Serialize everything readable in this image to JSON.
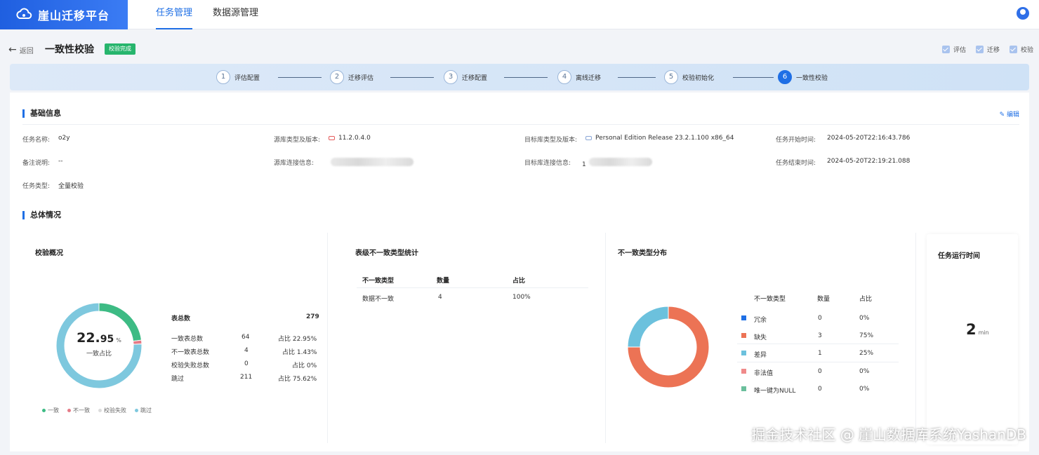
{
  "app": {
    "brand": "崖山迁移平台"
  },
  "nav": {
    "tabs": [
      {
        "label": "任务管理",
        "active": true
      },
      {
        "label": "数据源管理",
        "active": false
      }
    ]
  },
  "header": {
    "back_label": "返回",
    "title": "一致性校验",
    "status_badge": "校验完成",
    "checks": [
      {
        "label": "评估"
      },
      {
        "label": "迁移"
      },
      {
        "label": "校验"
      }
    ]
  },
  "stepper": {
    "steps": [
      {
        "num": "1",
        "label": "评估配置"
      },
      {
        "num": "2",
        "label": "迁移评估"
      },
      {
        "num": "3",
        "label": "迁移配置"
      },
      {
        "num": "4",
        "label": "离线迁移"
      },
      {
        "num": "5",
        "label": "校验初始化"
      },
      {
        "num": "6",
        "label": "一致性校验",
        "active": true
      }
    ]
  },
  "basic_info": {
    "title": "基础信息",
    "edit_label": "编辑",
    "task_name_label": "任务名称:",
    "task_name": "o2y",
    "remark_label": "备注说明:",
    "remark": "--",
    "task_type_label": "任务类型:",
    "task_type": "全量校验",
    "source_type_label": "源库类型及版本:",
    "source_type": "11.2.0.4.0",
    "source_conn_label": "源库连接信息:",
    "target_type_label": "目标库类型及版本:",
    "target_type": "Personal Edition Release 23.2.1.100 x86_64",
    "target_conn_label": "目标库连接信息:",
    "target_conn_prefix": "1",
    "start_time_label": "任务开始时间:",
    "start_time": "2024-05-20T22:16:43.786",
    "end_time_label": "任务结束时间:",
    "end_time": "2024-05-20T22:19:21.088"
  },
  "overview": {
    "title": "总体情况",
    "check_summary": {
      "title": "校验概况",
      "center_value_int": "22.",
      "center_value_dec": "95",
      "center_unit": "%",
      "center_label": "一致占比",
      "total_label": "表总数",
      "total_value": "279",
      "rows": [
        {
          "label": "一致表总数",
          "count": "64",
          "ratio": "占比 22.95%"
        },
        {
          "label": "不一致表总数",
          "count": "4",
          "ratio": "占比 1.43%"
        },
        {
          "label": "校验失败总数",
          "count": "0",
          "ratio": "占比 0%"
        },
        {
          "label": "跳过",
          "count": "211",
          "ratio": "占比 75.62%"
        }
      ],
      "legend": [
        {
          "label": "一致",
          "color": "#3dbb84"
        },
        {
          "label": "不一致",
          "color": "#e57b87"
        },
        {
          "label": "校验失败",
          "color": "#dcdcdc"
        },
        {
          "label": "跳过",
          "color": "#7ec8de"
        }
      ]
    },
    "table_stats": {
      "title": "表级不一致类型统计",
      "headers": [
        "不一致类型",
        "数量",
        "占比"
      ],
      "rows": [
        {
          "type": "数据不一致",
          "count": "4",
          "ratio": "100%"
        }
      ]
    },
    "type_dist": {
      "title": "不一致类型分布",
      "headers": [
        "不一致类型",
        "数量",
        "占比"
      ],
      "rows": [
        {
          "type": "冗余",
          "count": "0",
          "ratio": "0%",
          "color": "#1f6fe5"
        },
        {
          "type": "缺失",
          "count": "3",
          "ratio": "75%",
          "color": "#ec7355"
        },
        {
          "type": "差异",
          "count": "1",
          "ratio": "25%",
          "color": "#6cc1dd"
        },
        {
          "type": "非法值",
          "count": "0",
          "ratio": "0%",
          "color": "#f08a8a"
        },
        {
          "type": "唯一键为NULL",
          "count": "0",
          "ratio": "0%",
          "color": "#6bbf9c"
        }
      ]
    },
    "runtime": {
      "title": "任务运行时间",
      "value": "2",
      "unit": "min"
    }
  },
  "watermark": "掘金技术社区 @ 崖山数据库系统YashanDB",
  "chart_data": [
    {
      "type": "pie",
      "title": "校验概况",
      "categories": [
        "一致",
        "不一致",
        "校验失败",
        "跳过"
      ],
      "values": [
        64,
        4,
        0,
        211
      ],
      "colors": [
        "#3dbb84",
        "#e57b87",
        "#dcdcdc",
        "#7ec8de"
      ]
    },
    {
      "type": "pie",
      "title": "不一致类型分布",
      "categories": [
        "冗余",
        "缺失",
        "差异",
        "非法值",
        "唯一键为NULL"
      ],
      "values": [
        0,
        3,
        1,
        0,
        0
      ],
      "colors": [
        "#1f6fe5",
        "#ec7355",
        "#6cc1dd",
        "#f08a8a",
        "#6bbf9c"
      ]
    }
  ]
}
